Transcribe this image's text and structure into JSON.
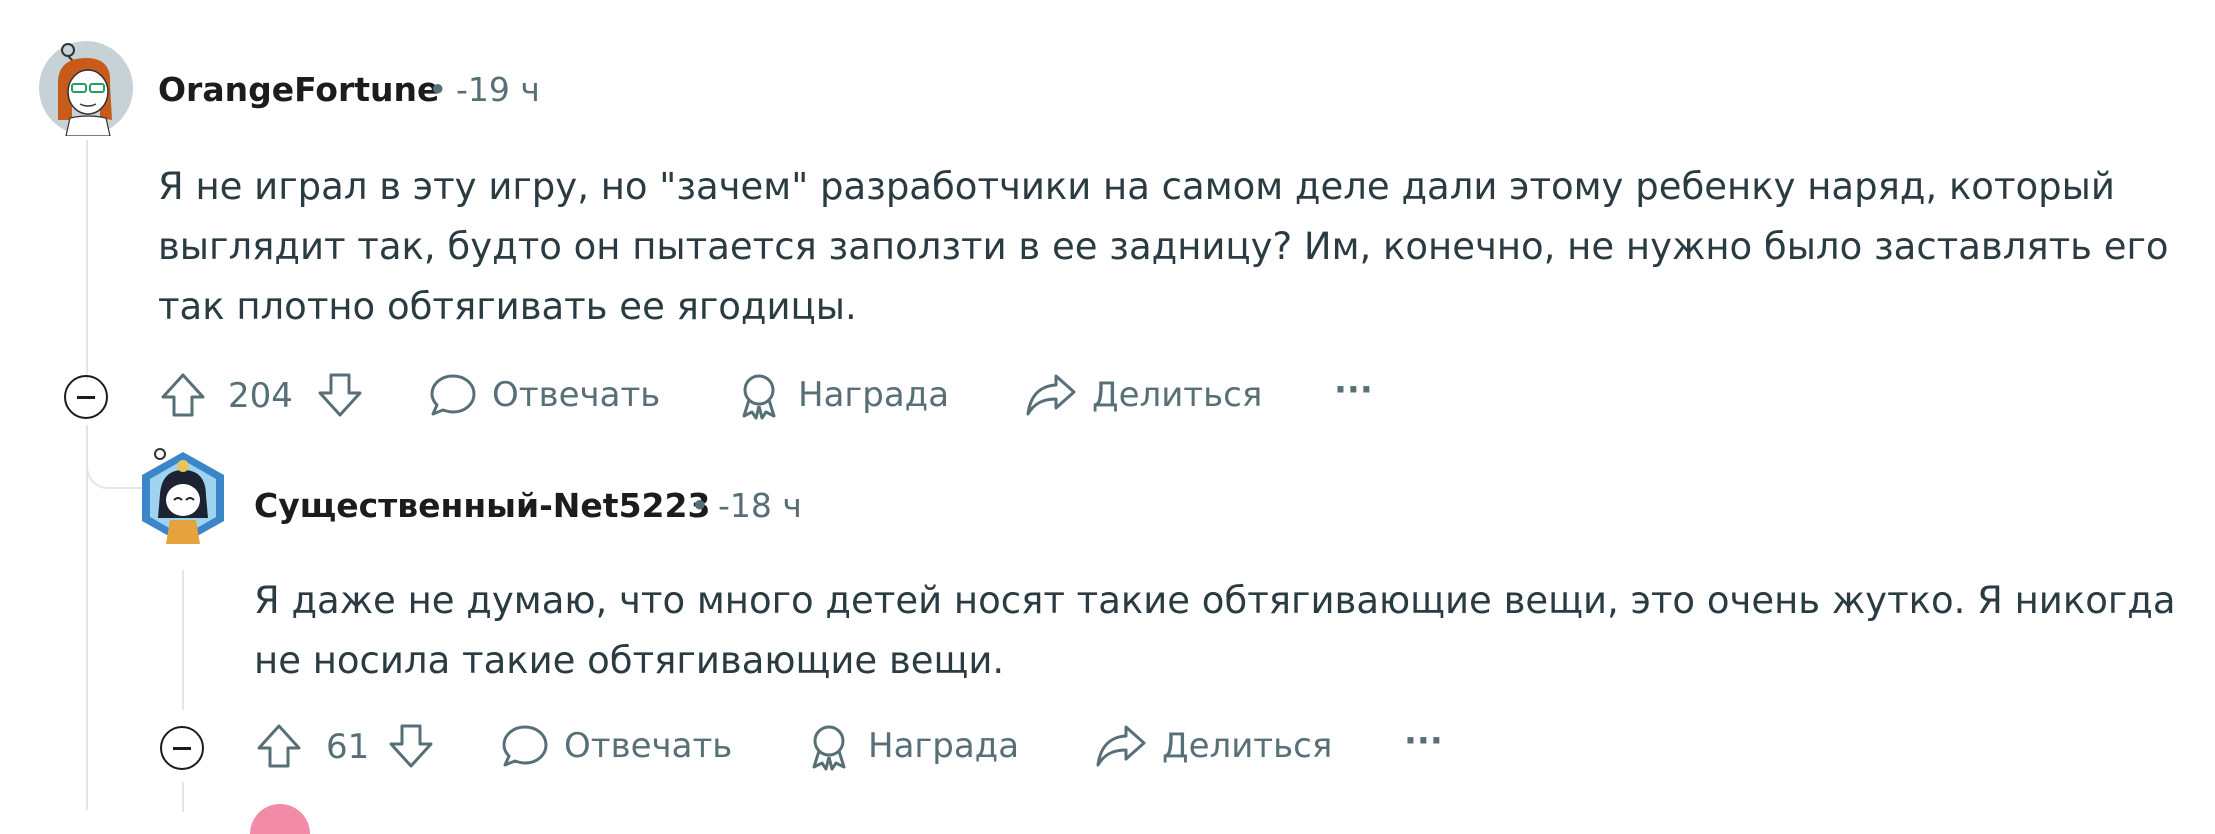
{
  "comments": [
    {
      "username": "OrangeFortune",
      "separator": "•",
      "time": "-19 ч",
      "body": "Я не играл в эту игру, но \"зачем\" разработчики на самом деле дали этому ребенку наряд, который выглядит так, будто он пытается заползти в ее задницу? Им, конечно, не нужно было заставлять его так плотно обтягивать ее ягодицы.",
      "score": "204",
      "reply_label": "Отвечать",
      "award_label": "Награда",
      "share_label": "Делиться",
      "more_label": "···"
    },
    {
      "username": "Существенный-Net5223",
      "separator": "•",
      "time": "-18 ч",
      "body": "Я даже не думаю, что много детей носят такие обтягивающие вещи, это очень жутко. Я никогда не носила такие обтягивающие вещи.",
      "score": "61",
      "reply_label": "Отвечать",
      "award_label": "Награда",
      "share_label": "Делиться",
      "more_label": "···"
    }
  ],
  "colors": {
    "text_primary": "#1a1c1e",
    "text_secondary": "#576f76",
    "body_text": "#2a3c42",
    "thread_line": "#e3e6e8",
    "avatar1_bg": "#c7d2d6",
    "avatar2_bg": "#3a86c8"
  },
  "icons": [
    "upvote-icon",
    "downvote-icon",
    "reply-bubble-icon",
    "award-icon",
    "share-icon",
    "more-icon",
    "collapse-icon"
  ]
}
